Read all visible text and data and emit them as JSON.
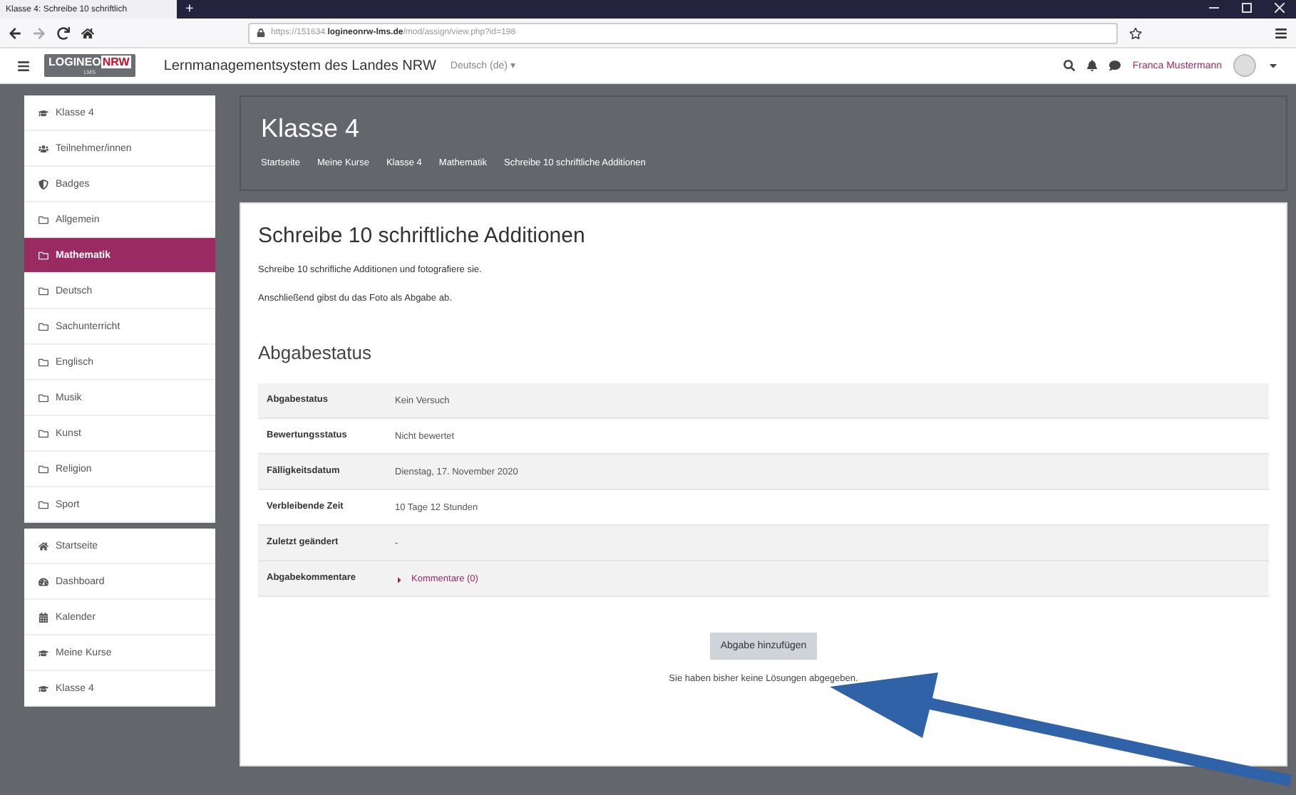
{
  "browser": {
    "tab_title": "Klasse 4: Schreibe 10 schriftlich",
    "new_tab": "+",
    "url_host": "https://151634.",
    "url_domain": "logineonrw-lms.de",
    "url_path": "/mod/assign/view.php?id=198"
  },
  "navbar": {
    "logo": "LOGINEO",
    "logo_accent": "NRW",
    "logo_sub": "LMS",
    "site_title": "Lernmanagementsystem des Landes NRW",
    "language": "Deutsch (de) ▾",
    "user": "Franca Mustermann"
  },
  "sidebar": {
    "groups": [
      [
        {
          "label": "Klasse 4",
          "kind": "course",
          "selected": false
        },
        {
          "label": "Teilnehmer/innen",
          "kind": "users",
          "selected": false
        },
        {
          "label": "Badges",
          "kind": "badge",
          "selected": false
        },
        {
          "label": "Allgemein",
          "kind": "folder",
          "selected": false
        },
        {
          "label": "Mathematik",
          "kind": "folder",
          "selected": true
        },
        {
          "label": "Deutsch",
          "kind": "folder",
          "selected": false
        },
        {
          "label": "Sachunterricht",
          "kind": "folder",
          "selected": false
        },
        {
          "label": "Englisch",
          "kind": "folder",
          "selected": false
        },
        {
          "label": "Musik",
          "kind": "folder",
          "selected": false
        },
        {
          "label": "Kunst",
          "kind": "folder",
          "selected": false
        },
        {
          "label": "Religion",
          "kind": "folder",
          "selected": false
        },
        {
          "label": "Sport",
          "kind": "folder",
          "selected": false
        }
      ],
      [
        {
          "label": "Startseite",
          "kind": "home",
          "selected": false
        },
        {
          "label": "Dashboard",
          "kind": "dashboard",
          "selected": false
        },
        {
          "label": "Kalender",
          "kind": "calendar",
          "selected": false
        },
        {
          "label": "Meine Kurse",
          "kind": "course",
          "selected": false
        },
        {
          "label": "Klasse 4",
          "kind": "course",
          "selected": false
        }
      ]
    ]
  },
  "header": {
    "title": "Klasse 4",
    "breadcrumbs": [
      "Startseite",
      "Meine Kurse",
      "Klasse 4",
      "Mathematik",
      "Schreibe 10 schriftliche Additionen"
    ]
  },
  "assignment": {
    "title": "Schreibe 10 schriftliche Additionen",
    "description": [
      "Schreibe 10 schrifliche Additionen und fotografiere sie.",
      "Anschließend gibst du das Foto als Abgabe ab."
    ],
    "status_heading": "Abgabestatus",
    "status_rows": [
      {
        "label": "Abgabestatus",
        "value": "Kein Versuch"
      },
      {
        "label": "Bewertungsstatus",
        "value": "Nicht bewertet"
      },
      {
        "label": "Fälligkeitsdatum",
        "value": "Dienstag, 17. November 2020"
      },
      {
        "label": "Verbleibende Zeit",
        "value": "10 Tage 12 Stunden"
      },
      {
        "label": "Zuletzt geändert",
        "value": "-"
      },
      {
        "label": "Abgabekommentare",
        "value": "Kommentare (0)",
        "kind": "link"
      }
    ],
    "submit_button": "Abgabe hinzufügen",
    "note": "Sie haben bisher keine Lösungen abgegeben."
  }
}
